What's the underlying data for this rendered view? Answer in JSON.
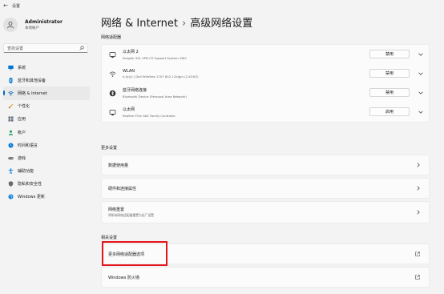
{
  "window": {
    "back_glyph": "←",
    "title": "设置"
  },
  "account": {
    "name": "Administrator",
    "type": "本地帐户"
  },
  "search": {
    "placeholder": "查找设置"
  },
  "sidebar": {
    "items": [
      {
        "label": "系统",
        "icon": "monitor-icon",
        "color": "#0078d4"
      },
      {
        "label": "蓝牙和其他设备",
        "icon": "bluetooth-icon",
        "color": "#0078d4"
      },
      {
        "label": "网络 & Internet",
        "icon": "wifi-icon",
        "color": "#0067c0",
        "selected": true
      },
      {
        "label": "个性化",
        "icon": "brush-icon",
        "color": "#e8a33a"
      },
      {
        "label": "应用",
        "icon": "apps-icon",
        "color": "#5d6b7a"
      },
      {
        "label": "帐户",
        "icon": "person-icon",
        "color": "#2aa36b"
      },
      {
        "label": "时间和语言",
        "icon": "globe-clock-icon",
        "color": "#0078d4"
      },
      {
        "label": "游戏",
        "icon": "gamepad-icon",
        "color": "#7a7a7a"
      },
      {
        "label": "辅助功能",
        "icon": "accessibility-icon",
        "color": "#0078d4"
      },
      {
        "label": "隐私和安全性",
        "icon": "shield-icon",
        "color": "#6b6b6b"
      },
      {
        "label": "Windows 更新",
        "icon": "update-icon",
        "color": "#0078d4"
      }
    ]
  },
  "header": {
    "parent": "网络 & Internet",
    "separator": "›",
    "current": "高级网络设置"
  },
  "adapters_section": {
    "title": "网络适配器"
  },
  "adapters": [
    {
      "name": "以太网 2",
      "desc": "Sangfor SSL VPN CS Support System VNIC",
      "button": "禁用",
      "icon": "ethernet-icon"
    },
    {
      "name": "WLAN",
      "desc": "e-ty(y) | Dell Wireless 1707 802.11b|g|n (2.4GHZ)",
      "button": "禁用",
      "icon": "wifi-icon"
    },
    {
      "name": "蓝牙网络连接",
      "desc": "Bluetooth Device (Personal Area Network)",
      "button": "禁用",
      "icon": "bluetooth-network-icon"
    },
    {
      "name": "以太网",
      "desc": "Realtek PCIe GbE Family Controller",
      "button": "启用",
      "icon": "ethernet-icon"
    }
  ],
  "more_settings": {
    "title": "更多设置",
    "items": [
      {
        "title": "数据使用量",
        "sub": ""
      },
      {
        "title": "硬件和连接属性",
        "sub": ""
      },
      {
        "title": "网络重置",
        "sub": "将所有网络适配器重置为出厂设置"
      }
    ]
  },
  "related": {
    "title": "相关设置",
    "items": [
      {
        "title": "更多网络适配器选项"
      },
      {
        "title": "Windows 防火墙"
      }
    ]
  },
  "colors": {
    "accent": "#0067c0",
    "highlight": "#e3141c"
  }
}
